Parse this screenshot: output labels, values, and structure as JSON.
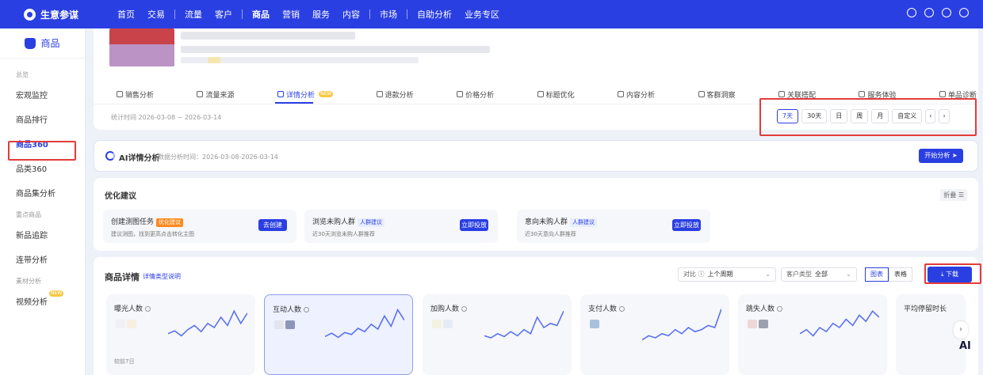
{
  "app": {
    "name": "生意参谋",
    "logo_icon": "logo-icon"
  },
  "nav": {
    "items": [
      {
        "label": "首页",
        "bold": false
      },
      {
        "label": "交易",
        "bold": false
      },
      {
        "sep": true
      },
      {
        "label": "流量",
        "bold": false
      },
      {
        "label": "客户",
        "bold": false
      },
      {
        "sep": true
      },
      {
        "label": "商品",
        "bold": true
      },
      {
        "label": "营销",
        "bold": false
      },
      {
        "label": "服务",
        "bold": false
      },
      {
        "label": "内容",
        "bold": false
      },
      {
        "sep": true
      },
      {
        "label": "市场",
        "bold": false
      },
      {
        "sep": true
      },
      {
        "label": "自助分析",
        "bold": false
      },
      {
        "label": "业务专区",
        "bold": false
      }
    ],
    "icons": [
      "message-icon",
      "user-icon",
      "help-icon",
      "logout-icon"
    ]
  },
  "sidebar": {
    "header": "商品",
    "entries": [
      {
        "type": "group",
        "label": "总览"
      },
      {
        "type": "item",
        "label": "宏观监控"
      },
      {
        "type": "item",
        "label": "商品排行"
      },
      {
        "type": "item",
        "label": "商品360",
        "active": true
      },
      {
        "type": "item",
        "label": "品类360"
      },
      {
        "type": "item",
        "label": "商品集分析"
      },
      {
        "type": "group",
        "label": "重点商品"
      },
      {
        "type": "item",
        "label": "新品追踪"
      },
      {
        "type": "item",
        "label": "连带分析"
      },
      {
        "type": "group",
        "label": "素材分析"
      },
      {
        "type": "item",
        "label": "视频分析",
        "badge": "NEW"
      }
    ]
  },
  "tabs": [
    {
      "label": "销售分析",
      "icon": "bag-icon"
    },
    {
      "label": "流量来源",
      "icon": "flow-icon"
    },
    {
      "label": "详情分析",
      "icon": "detail-icon",
      "active": true,
      "badge": "NEW"
    },
    {
      "label": "退款分析",
      "icon": "refund-icon"
    },
    {
      "label": "价格分析",
      "icon": "price-icon"
    },
    {
      "label": "标题优化",
      "icon": "title-icon"
    },
    {
      "label": "内容分析",
      "icon": "content-icon"
    },
    {
      "label": "客群洞察",
      "icon": "people-icon"
    },
    {
      "label": "关联搭配",
      "icon": "link-icon"
    },
    {
      "label": "服务体验",
      "icon": "service-icon"
    },
    {
      "label": "单品诊断",
      "icon": "diagnose-icon"
    }
  ],
  "stat_time": "统计时间 2026-03-08 ~ 2026-03-14",
  "date_range": {
    "buttons": [
      "7天",
      "30天",
      "日",
      "周",
      "月",
      "自定义"
    ],
    "active": "7天",
    "prev": "‹",
    "next": "›"
  },
  "ai": {
    "title": "AI详情分析",
    "time": "数据分析时间：2026-03-08-2026-03-14",
    "button": "开始分析"
  },
  "optimization": {
    "title": "优化建议",
    "fold": "折叠",
    "tasks": [
      {
        "title": "创建测图任务",
        "tag": "优化建议",
        "tag_style": "orange",
        "desc": "建议测图，找到更高点击转化主图",
        "button": "去创建"
      },
      {
        "title": "浏览未购人群",
        "tag": "人群建议",
        "tag_style": "blue",
        "desc": "近30天浏览未购人群推荐",
        "button": "立即投放"
      },
      {
        "title": "意向未购人群",
        "tag": "人群建议",
        "tag_style": "blue",
        "desc": "近30天意向人群推荐",
        "button": "立即投放"
      }
    ]
  },
  "detail": {
    "title": "商品详情",
    "link": "详情类型说明",
    "compare_label": "对比",
    "compare_value": "上个周期",
    "customer_label": "客户类型",
    "customer_value": "全部",
    "view_chart": "图表",
    "view_table": "表格",
    "download": "下载",
    "metrics": [
      {
        "label": "曝光人数",
        "foot": "较前7日",
        "selected": false,
        "trend": [
          0.35,
          0.42,
          0.3,
          0.45,
          0.55,
          0.4,
          0.6,
          0.5,
          0.75,
          0.55,
          0.9,
          0.6,
          0.85
        ]
      },
      {
        "label": "互动人数",
        "foot": "",
        "selected": true,
        "trend": [
          0.3,
          0.38,
          0.28,
          0.4,
          0.35,
          0.5,
          0.42,
          0.6,
          0.48,
          0.8,
          0.55,
          0.95,
          0.7
        ]
      },
      {
        "label": "加购人数",
        "foot": "",
        "selected": false,
        "trend": [
          0.3,
          0.25,
          0.35,
          0.28,
          0.4,
          0.3,
          0.45,
          0.35,
          0.75,
          0.5,
          0.6,
          0.55,
          0.9
        ]
      },
      {
        "label": "支付人数",
        "foot": "",
        "selected": false,
        "trend": [
          0.2,
          0.3,
          0.25,
          0.35,
          0.3,
          0.45,
          0.35,
          0.5,
          0.4,
          0.45,
          0.55,
          0.5,
          0.95
        ]
      },
      {
        "label": "跳失人数",
        "foot": "",
        "selected": false,
        "trend": [
          0.35,
          0.45,
          0.3,
          0.5,
          0.4,
          0.6,
          0.5,
          0.7,
          0.55,
          0.8,
          0.65,
          0.9,
          0.75
        ]
      },
      {
        "label": "平均停留时长",
        "foot": "",
        "selected": false,
        "trend": []
      }
    ]
  },
  "colors": {
    "brand": "#2a3fe2",
    "highlight": "#e23c3c",
    "orange": "#ff8a1f",
    "spark": "#5a72f0"
  },
  "float": {
    "next": "›",
    "ai": "AI"
  }
}
